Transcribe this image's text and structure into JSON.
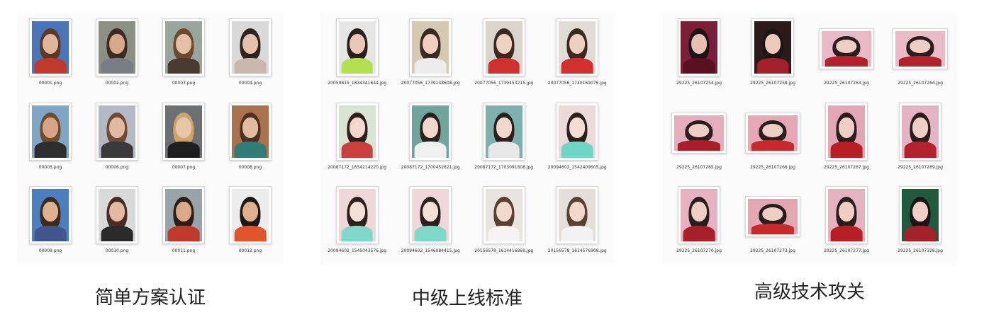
{
  "panels": [
    {
      "caption": "简单方案认证",
      "files": [
        {
          "name": "00001.png",
          "bg": "#4a74b8",
          "skin": "#e0b59a",
          "hair": "#5a3a24",
          "body": "#c0392b",
          "shape": "portrait"
        },
        {
          "name": "00002.png",
          "bg": "#8c8f84",
          "skin": "#d7a98a",
          "hair": "#3b2b20",
          "body": "#7a7e84",
          "shape": "portrait"
        },
        {
          "name": "00003.png",
          "bg": "#9aa59e",
          "skin": "#e3c0a6",
          "hair": "#6b4a2f",
          "body": "#4b3b2f",
          "shape": "portrait"
        },
        {
          "name": "00004.png",
          "bg": "#d9d9d9",
          "skin": "#e6c2aa",
          "hair": "#2d241f",
          "body": "#c9b8ab",
          "shape": "portrait"
        },
        {
          "name": "00005.png",
          "bg": "#7fa6c7",
          "skin": "#d8a483",
          "hair": "#6c4d2f",
          "body": "#2e2e2e",
          "shape": "portrait"
        },
        {
          "name": "00006.png",
          "bg": "#b5b9c3",
          "skin": "#e2b9a0",
          "hair": "#6d4c36",
          "body": "#3a3a3a",
          "shape": "portrait"
        },
        {
          "name": "00007.png",
          "bg": "#6d6f72",
          "skin": "#e8c5a8",
          "hair": "#c9a76a",
          "body": "#1e1e1e",
          "shape": "portrait"
        },
        {
          "name": "00008.png",
          "bg": "#a9724d",
          "skin": "#e4bba1",
          "hair": "#4a3222",
          "body": "#2f7d76",
          "shape": "portrait"
        },
        {
          "name": "00009.png",
          "bg": "#4b7fc0",
          "skin": "#e0b190",
          "hair": "#3d2b1e",
          "body": "#40568c",
          "shape": "portrait"
        },
        {
          "name": "00010.png",
          "bg": "#d9d9d9",
          "skin": "#e3b9a1",
          "hair": "#4a2c22",
          "body": "#2a2a2a",
          "shape": "portrait"
        },
        {
          "name": "00011.png",
          "bg": "#9aa4a6",
          "skin": "#d9a988",
          "hair": "#2b2019",
          "body": "#c0392b",
          "shape": "portrait"
        },
        {
          "name": "00012.png",
          "bg": "#ececec",
          "skin": "#dfb08c",
          "hair": "#1e1814",
          "body": "#e2552b",
          "shape": "portrait"
        }
      ]
    },
    {
      "caption": "中级上线标准",
      "files": [
        {
          "name": "20059815_1834341644.jpg",
          "bg": "#e6e6e6",
          "skin": "#e9c7b4",
          "hair": "#2a201b",
          "body": "#b3e04f",
          "shape": "portrait"
        },
        {
          "name": "20077056_1739138608.jpg",
          "bg": "#d6c9b1",
          "skin": "#efd0c0",
          "hair": "#3a2a20",
          "body": "#ececec",
          "shape": "portrait"
        },
        {
          "name": "20077056_1739453215.jpg",
          "bg": "#d9d4cc",
          "skin": "#f0d2c4",
          "hair": "#3a2a20",
          "body": "#d1302e",
          "shape": "portrait"
        },
        {
          "name": "20077056_1740169076.jpg",
          "bg": "#e2dcd6",
          "skin": "#efcfc1",
          "hair": "#3a2a20",
          "body": "#d1302e",
          "shape": "portrait"
        },
        {
          "name": "20087172_1654214220.jpg",
          "bg": "#d9e4d4",
          "skin": "#f3d6cc",
          "hair": "#2b201b",
          "body": "#c9403e",
          "shape": "portrait"
        },
        {
          "name": "20087172_1700452621.jpg",
          "bg": "#6fa59b",
          "skin": "#f2d7cc",
          "hair": "#2b201b",
          "body": "#f0f0f0",
          "shape": "portrait"
        },
        {
          "name": "20087172_1703091808.jpg",
          "bg": "#7eb1ad",
          "skin": "#f2d7cc",
          "hair": "#2b201b",
          "body": "#e8e8e8",
          "shape": "portrait"
        },
        {
          "name": "20094602_1542409605.jpg",
          "bg": "#ecd9d9",
          "skin": "#f4ddd4",
          "hair": "#2b201b",
          "body": "#6fd6c6",
          "shape": "portrait"
        },
        {
          "name": "20094602_1545043576.jpg",
          "bg": "#f0d8d8",
          "skin": "#f5ded6",
          "hair": "#2b201b",
          "body": "#7fd9c9",
          "shape": "portrait"
        },
        {
          "name": "20094602_1546084415.jpg",
          "bg": "#f0d8d8",
          "skin": "#f5ded6",
          "hair": "#2b201b",
          "body": "#7fd9c9",
          "shape": "portrait"
        },
        {
          "name": "20156578_1614416869.jpg",
          "bg": "#e8e4e0",
          "skin": "#f2d9cd",
          "hair": "#5a4030",
          "body": "#f4f4f4",
          "shape": "portrait"
        },
        {
          "name": "20156578_1614576908.jpg",
          "bg": "#e4dfda",
          "skin": "#f2d9cd",
          "hair": "#5a4030",
          "body": "#f2f2f2",
          "shape": "portrait"
        }
      ]
    },
    {
      "caption": "高级技术攻关",
      "files": [
        {
          "name": "29225_26107254.jpg",
          "bg": "#7a1e3a",
          "skin": "#e6c0b0",
          "hair": "#1d1417",
          "body": "#5a0f22",
          "shape": "portrait"
        },
        {
          "name": "29225_26107258.jpg",
          "bg": "#2a1a1c",
          "skin": "#ecc9ba",
          "hair": "#1d1417",
          "body": "#a3202b",
          "shape": "portrait"
        },
        {
          "name": "29225_26107263.jpg",
          "bg": "#e8b9c7",
          "skin": "#efcfc3",
          "hair": "#2a1d1d",
          "body": "#b3212b",
          "shape": "land"
        },
        {
          "name": "29225_26107264.jpg",
          "bg": "#e9bcc8",
          "skin": "#efcfc3",
          "hair": "#2a1d1d",
          "body": "#b3212b",
          "shape": "land"
        },
        {
          "name": "29225_26107265.jpg",
          "bg": "#e5aebf",
          "skin": "#efcfc3",
          "hair": "#2a1d1d",
          "body": "#a81f2a",
          "shape": "land"
        },
        {
          "name": "29225_26107266.jpg",
          "bg": "#e6a8b6",
          "skin": "#efcfc3",
          "hair": "#2a1d1d",
          "body": "#c62a2a",
          "shape": "land"
        },
        {
          "name": "29225_26107267.jpg",
          "bg": "#e3a7b8",
          "skin": "#efcfc3",
          "hair": "#2a1d1d",
          "body": "#b81f25",
          "shape": "portrait"
        },
        {
          "name": "29225_26107269.jpg",
          "bg": "#e5b3c3",
          "skin": "#efcfc3",
          "hair": "#2a1d1d",
          "body": "#b3212b",
          "shape": "portrait"
        },
        {
          "name": "29225_26107270.jpg",
          "bg": "#e6b1c1",
          "skin": "#efcfc3",
          "hair": "#2a1d1d",
          "body": "#a81f2a",
          "shape": "portrait"
        },
        {
          "name": "29225_26107273.jpg",
          "bg": "#e3a7b2",
          "skin": "#efcfc3",
          "hair": "#2a1d1d",
          "body": "#c62a2a",
          "shape": "land"
        },
        {
          "name": "29225_26107277.jpg",
          "bg": "#e5b2c0",
          "skin": "#efcfc3",
          "hair": "#2a1d1d",
          "body": "#b81f25",
          "shape": "portrait"
        },
        {
          "name": "29225_26107328.jpg",
          "bg": "#1f5a3c",
          "skin": "#efcfc3",
          "hair": "#1d1417",
          "body": "#a3202b",
          "shape": "portrait"
        }
      ]
    }
  ]
}
